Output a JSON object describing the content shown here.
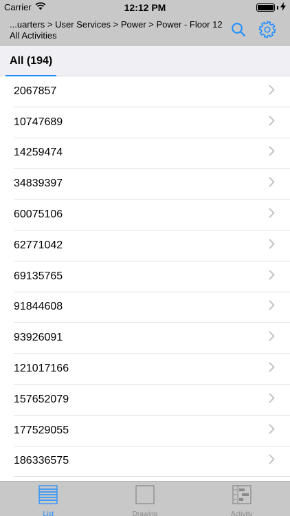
{
  "status": {
    "carrier": "Carrier",
    "time": "12:12 PM",
    "battery_level": 1.0
  },
  "header": {
    "breadcrumb": "...uarters > User Services > Power > Power - Floor 12",
    "subtitle": "All Activities",
    "search_icon": "search-icon",
    "settings_icon": "gear-icon",
    "accent_color": "#1a8cff"
  },
  "tabs": [
    {
      "label": "All (194)",
      "selected": true
    }
  ],
  "list": {
    "items": [
      "2067857",
      "10747689",
      "14259474",
      "34839397",
      "60075106",
      "62771042",
      "69135765",
      "91844608",
      "93926091",
      "121017166",
      "157652079",
      "177529055",
      "186336575"
    ]
  },
  "tabbar": {
    "items": [
      {
        "label": "List",
        "icon": "list-icon",
        "active": true
      },
      {
        "label": "Drawing",
        "icon": "drawing-icon",
        "active": false
      },
      {
        "label": "Activity",
        "icon": "activity-icon",
        "active": false
      }
    ]
  }
}
